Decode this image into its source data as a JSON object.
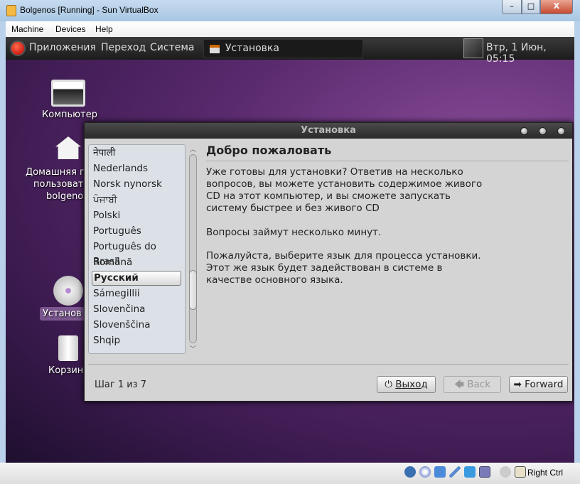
{
  "window": {
    "title": "Bolgenos [Running] - Sun VirtualBox",
    "minimize": "–",
    "maximize": "□",
    "close": "X"
  },
  "menu": [
    "Machine",
    "Devices",
    "Help"
  ],
  "panel": {
    "menus": [
      "Приложения",
      "Переход",
      "Система"
    ],
    "task": "Установка",
    "clock": "Втр,  1 Июн, 05:15"
  },
  "desktop": {
    "icons": [
      {
        "label": "Компьютер"
      },
      {
        "label": "Домашняя папка пользователя bolgenos"
      },
      {
        "label": "Установка"
      },
      {
        "label": "Корзина"
      }
    ],
    "home_lines": [
      "Домашняя п",
      "пользоват",
      "bolgeno"
    ],
    "install_short": "Установ",
    "trash_short": "Корзин"
  },
  "dialog": {
    "title": "Установка",
    "languages": [
      "नेपाली",
      "Nederlands",
      "Norsk nynorsk",
      "ਪੰਜਾਬੀ",
      "Polski",
      "Português",
      "Português do Brasil",
      "Română",
      "Русский",
      "Sámegillii",
      "Slovenčina",
      "Slovenščina",
      "Shqip"
    ],
    "selected": "Русский",
    "heading": "Добро пожаловать",
    "para1": [
      "Уже готовы для установки? Ответив на несколько",
      "вопросов, вы можете установить содержимое живого",
      "CD на этот компьютер, и вы сможете запускать",
      "систему быстрее и без живого CD"
    ],
    "para2": "Вопросы займут несколько минут.",
    "para3": [
      "Пожалуйста, выберите язык для процесса установки.",
      "Этот же язык будет задействован в системе в",
      "качестве основного языка."
    ],
    "step": "Шаг 1 из 7",
    "quit": "Выход",
    "back": "Back",
    "forward": "Forward"
  },
  "statusbar": {
    "host_key": "Right Ctrl"
  }
}
